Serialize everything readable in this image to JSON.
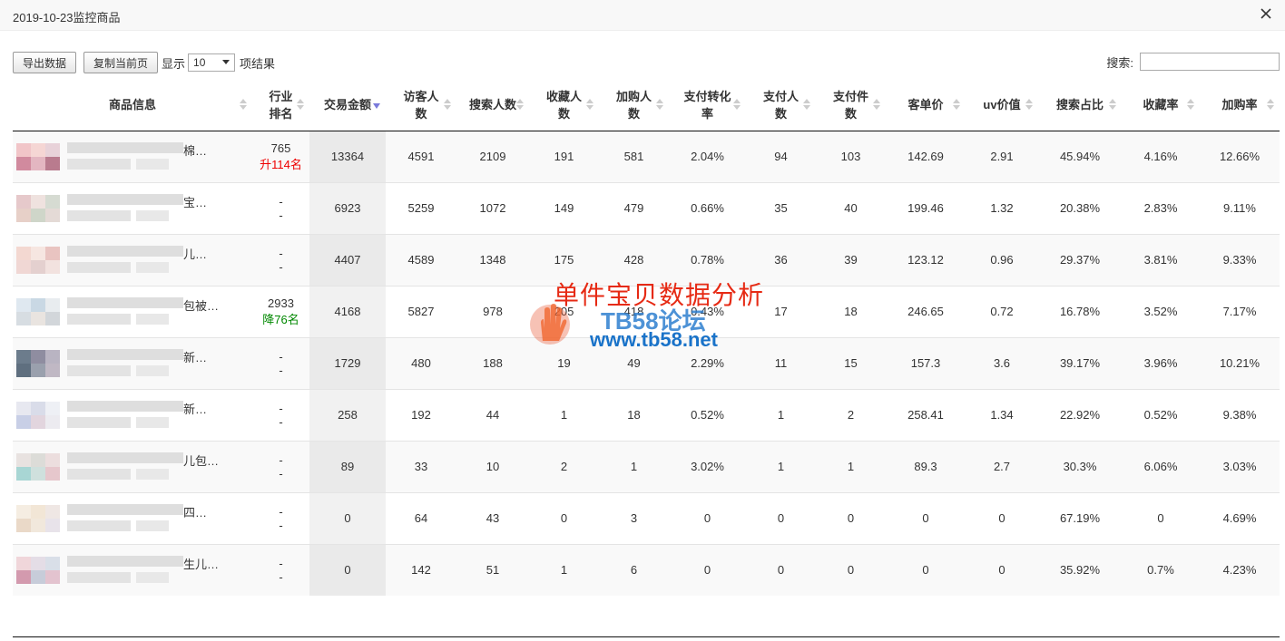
{
  "window": {
    "title": "2019-10-23监控商品"
  },
  "toolbar": {
    "export_label": "导出数据",
    "copy_label": "复制当前页",
    "length_prefix": "显示",
    "length_value": "10",
    "length_suffix": "项结果"
  },
  "search": {
    "label": "搜索:",
    "value": ""
  },
  "table": {
    "columns": [
      "商品信息",
      "行业排名",
      "交易金额",
      "访客人数",
      "搜索人数",
      "收藏人数",
      "加购人数",
      "支付转化率",
      "支付人数",
      "支付件数",
      "客单价",
      "uv价值",
      "搜索占比",
      "收藏率",
      "加购率"
    ],
    "rows": [
      {
        "tail": "棉…",
        "rank": "765",
        "rank_change": "升114名",
        "rank_dir": "up",
        "amount": "13364",
        "visitors": "4591",
        "searchers": "2109",
        "favs": "191",
        "carts": "581",
        "conv": "2.04%",
        "payers": "94",
        "items": "103",
        "aov": "142.69",
        "uv": "2.91",
        "search_ratio": "45.94%",
        "fav_rate": "4.16%",
        "cart_rate": "12.66%",
        "thumb": [
          "#f1c5c8",
          "#f5d6d4",
          "#e8d2d9",
          "#d18a9e",
          "#e3b6c1",
          "#b97b8e"
        ]
      },
      {
        "tail": "宝…",
        "rank": "-",
        "rank_change": "-",
        "rank_dir": "none",
        "amount": "6923",
        "visitors": "5259",
        "searchers": "1072",
        "favs": "149",
        "carts": "479",
        "conv": "0.66%",
        "payers": "35",
        "items": "40",
        "aov": "199.46",
        "uv": "1.32",
        "search_ratio": "20.38%",
        "fav_rate": "2.83%",
        "cart_rate": "9.11%",
        "thumb": [
          "#e6c9cb",
          "#efe2df",
          "#d6dbd2",
          "#e7d0c8",
          "#cfd6c9",
          "#e4dad6"
        ]
      },
      {
        "tail": "儿…",
        "rank": "-",
        "rank_change": "-",
        "rank_dir": "none",
        "amount": "4407",
        "visitors": "4589",
        "searchers": "1348",
        "favs": "175",
        "carts": "428",
        "conv": "0.78%",
        "payers": "36",
        "items": "39",
        "aov": "123.12",
        "uv": "0.96",
        "search_ratio": "29.37%",
        "fav_rate": "3.81%",
        "cart_rate": "9.33%",
        "thumb": [
          "#f3d8d1",
          "#f6e6e1",
          "#e9c4c1",
          "#f0d7d4",
          "#e4d0cf",
          "#f2e2df"
        ]
      },
      {
        "tail": "包被…",
        "rank": "2933",
        "rank_change": "降76名",
        "rank_dir": "down",
        "amount": "4168",
        "visitors": "5827",
        "searchers": "978",
        "favs": "205",
        "carts": "418",
        "conv": "0.43%",
        "payers": "17",
        "items": "18",
        "aov": "246.65",
        "uv": "0.72",
        "search_ratio": "16.78%",
        "fav_rate": "3.52%",
        "cart_rate": "7.17%",
        "thumb": [
          "#dfe8f0",
          "#c9d8e4",
          "#e8ecef",
          "#d7dde2",
          "#e9e4e0",
          "#d2d6da"
        ]
      },
      {
        "tail": "新…",
        "rank": "-",
        "rank_change": "-",
        "rank_dir": "none",
        "amount": "1729",
        "visitors": "480",
        "searchers": "188",
        "favs": "19",
        "carts": "49",
        "conv": "2.29%",
        "payers": "11",
        "items": "15",
        "aov": "157.3",
        "uv": "3.6",
        "search_ratio": "39.17%",
        "fav_rate": "3.96%",
        "cart_rate": "10.21%",
        "thumb": [
          "#6c7c8c",
          "#8f8da0",
          "#b9b4c2",
          "#5f6f7f",
          "#9aa0ad",
          "#c0b8c4"
        ]
      },
      {
        "tail": "新…",
        "rank": "-",
        "rank_change": "-",
        "rank_dir": "none",
        "amount": "258",
        "visitors": "192",
        "searchers": "44",
        "favs": "1",
        "carts": "18",
        "conv": "0.52%",
        "payers": "1",
        "items": "2",
        "aov": "258.41",
        "uv": "1.34",
        "search_ratio": "22.92%",
        "fav_rate": "0.52%",
        "cart_rate": "9.38%",
        "thumb": [
          "#e7e8f0",
          "#d9dce9",
          "#eef0f5",
          "#c8cfe6",
          "#e2d5de",
          "#ecebf0"
        ]
      },
      {
        "tail": "儿包…",
        "rank": "-",
        "rank_change": "-",
        "rank_dir": "none",
        "amount": "89",
        "visitors": "33",
        "searchers": "10",
        "favs": "2",
        "carts": "1",
        "conv": "3.02%",
        "payers": "1",
        "items": "1",
        "aov": "89.3",
        "uv": "2.7",
        "search_ratio": "30.3%",
        "fav_rate": "6.06%",
        "cart_rate": "3.03%",
        "thumb": [
          "#e8e2e0",
          "#dcdcd8",
          "#ecdede",
          "#a8d6d4",
          "#cfe0dd",
          "#e6c7cc"
        ]
      },
      {
        "tail": "四…",
        "rank": "-",
        "rank_change": "-",
        "rank_dir": "none",
        "amount": "0",
        "visitors": "64",
        "searchers": "43",
        "favs": "0",
        "carts": "3",
        "conv": "0",
        "payers": "0",
        "items": "0",
        "aov": "0",
        "uv": "0",
        "search_ratio": "67.19%",
        "fav_rate": "0",
        "cart_rate": "4.69%",
        "thumb": [
          "#f5ede2",
          "#f2e6d6",
          "#efe7e4",
          "#ead9c8",
          "#f1e8dc",
          "#e8e3ea"
        ]
      },
      {
        "tail": "生儿…",
        "rank": "-",
        "rank_change": "-",
        "rank_dir": "none",
        "amount": "0",
        "visitors": "142",
        "searchers": "51",
        "favs": "1",
        "carts": "6",
        "conv": "0",
        "payers": "0",
        "items": "0",
        "aov": "0",
        "uv": "0",
        "search_ratio": "35.92%",
        "fav_rate": "0.7%",
        "cart_rate": "4.23%",
        "thumb": [
          "#f0d6da",
          "#e4dde6",
          "#d9dfe8",
          "#d39aae",
          "#c7ccd9",
          "#e3c3cf"
        ]
      }
    ]
  },
  "watermark": {
    "line1": "单件宝贝数据分析",
    "line2": "TB58论坛",
    "line3": "www.tb58.net"
  }
}
